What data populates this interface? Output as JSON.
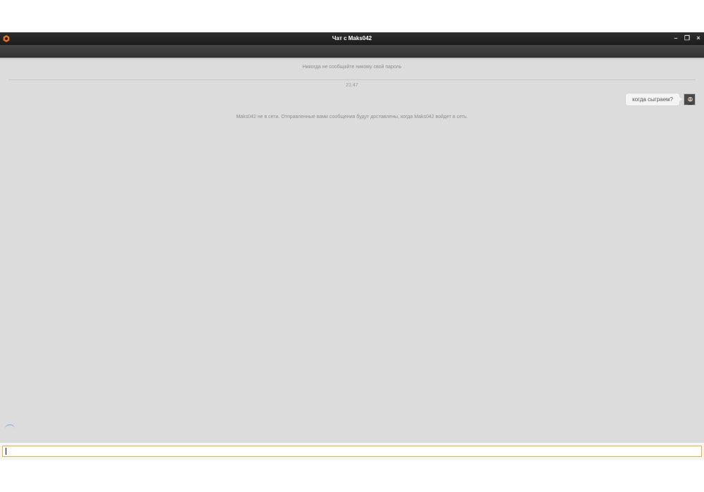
{
  "window": {
    "title": "Чат с Maks042",
    "controls": {
      "minimize": "–",
      "restore": "❐",
      "close": "×"
    }
  },
  "chat": {
    "security_notice": "Никогда не сообщайте никому свой пароль",
    "divider_time": "21:47",
    "messages": [
      {
        "text": "когда сыграем?",
        "direction": "outgoing"
      }
    ],
    "offline_notice": "Maks042 не в сети. Отправленные вами сообщения будут доставлены, когда Maks042 войдет в сеть."
  },
  "composer": {
    "value": "",
    "placeholder": ""
  },
  "colors": {
    "titlebar": "#1f1f1f",
    "toolbar": "#3d3d3d",
    "chat_background": "#dcdcdc",
    "input_border": "#f0b030",
    "app_icon": "#e8731e"
  },
  "icons": {
    "app": "app-logo-icon",
    "minimize": "minimize-icon",
    "restore": "restore-icon",
    "close": "close-icon"
  }
}
